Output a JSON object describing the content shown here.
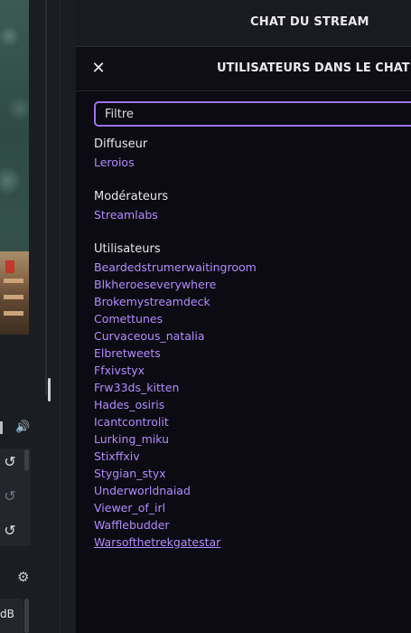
{
  "left_panel": {
    "audio_unit": "dB"
  },
  "chat": {
    "header_title": "CHAT DU STREAM",
    "users_title": "UTILISATEURS DANS LE CHAT",
    "close_icon": "close-icon",
    "filter_placeholder": "Filtre",
    "sections": {
      "broadcaster": {
        "label": "Diffuseur",
        "users": [
          "Leroios"
        ]
      },
      "moderators": {
        "label": "Modérateurs",
        "users": [
          "Streamlabs"
        ]
      },
      "users": {
        "label": "Utilisateurs",
        "users": [
          "Beardedstrumerwaitingroom",
          "Blkheroeseverywhere",
          "Brokemystreamdeck",
          "Comettunes",
          "Curvaceous_natalia",
          "Elbretweets",
          "Ffxivstyx",
          "Frw33ds_kitten",
          "Hades_osiris",
          "Icantcontrolit",
          "Lurking_miku",
          "Stixffxiv",
          "Stygian_styx",
          "Underworldnaiad",
          "Viewer_of_irl",
          "Wafflebudder",
          "Warsofthetrekgatestar"
        ]
      }
    }
  },
  "colors": {
    "accent": "#9b74e8",
    "username": "#b18cff",
    "panel_bg": "#0c0a12"
  }
}
